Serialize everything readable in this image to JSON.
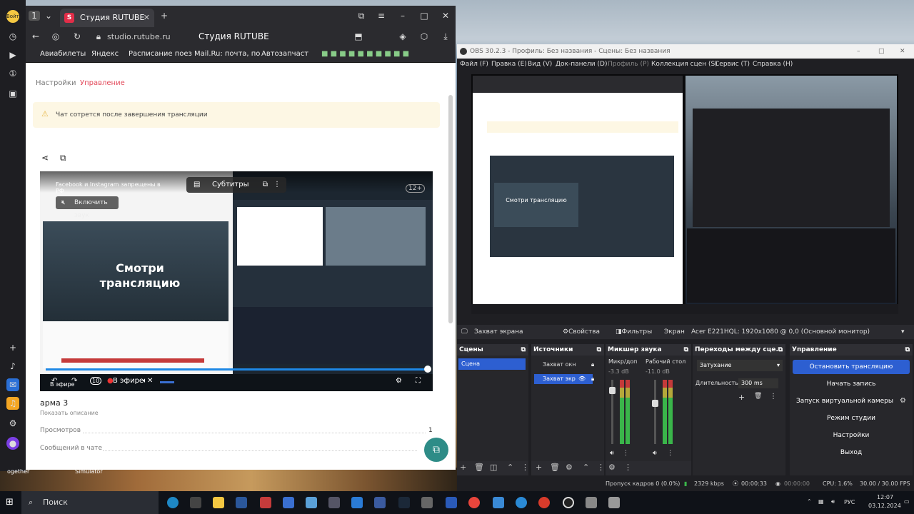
{
  "browser": {
    "tab_label": "Студия RUTUBE",
    "tab_icon": "S",
    "url": "studio.rutube.ru",
    "page_title": "Студия RUTUBE",
    "bookmarks": [
      "Авиабилеты",
      "Яндекс",
      "Расписание поез",
      "Mail.Ru: почта, по",
      "Автозапчаст"
    ]
  },
  "sidebar": {
    "login_label": "Войти",
    "bottom_label": "ogether"
  },
  "studio": {
    "tabs": [
      "Настройки",
      "Управление"
    ],
    "notice": "Чат сотрется после завершения трансляции",
    "player": {
      "overlay_title": "Facebook и Instagram запрещены в РФ",
      "subtitles_label": "Субтитры",
      "mute_label": "Включить звук",
      "age_badge": "12+",
      "big_text": "Смотри трансляцию",
      "small_text": "Смотри трансляцию",
      "live_label": "В эфире",
      "live_label_2": "В эфире",
      "skip_label": "10"
    },
    "video_title": "арма 3",
    "show_description": "Показать описание",
    "views_label": "Просмотров",
    "views_value": "1",
    "chat_label": "Сообщений в чате"
  },
  "obs": {
    "title": "OBS 30.2.3 - Профиль: Без названия - Сцены: Без названия",
    "menu": [
      "Файл (F)",
      "Правка (E)",
      "Вид (V)",
      "Док-панели (D)",
      "Профиль (P)",
      "Коллекция сцен (S)",
      "Сервис (T)",
      "Справка (H)"
    ],
    "source_bar": {
      "source_name": "Захват экрана",
      "properties": "Свойства",
      "filters": "Фильтры",
      "screen_label": "Экран",
      "monitor": "Acer E221HQL: 1920x1080 @ 0,0 (Основной монитор)"
    },
    "scenes": {
      "header": "Сцены",
      "items": [
        "Сцена"
      ]
    },
    "sources": {
      "header": "Источники",
      "items": [
        "Захват окн",
        "Захват экр"
      ]
    },
    "mixer": {
      "header": "Микшер звука",
      "channels": [
        {
          "label": "Микр/доп",
          "db": "-3.3 dB"
        },
        {
          "label": "Рабочий стол",
          "db": "-11.0 dB"
        }
      ],
      "scale": [
        "0",
        "-5",
        "-10",
        "-15",
        "-20",
        "-25",
        "-30",
        "-35",
        "-40",
        "-45",
        "-50",
        "-55",
        "-60"
      ]
    },
    "transitions": {
      "header": "Переходы между сце...",
      "type": "Затухание",
      "duration_label": "Длительность",
      "duration_value": "300 ms"
    },
    "controls": {
      "header": "Управление",
      "buttons": [
        "Остановить трансляцию",
        "Начать запись",
        "Запуск виртуальной камеры",
        "Режим студии",
        "Настройки",
        "Выход"
      ]
    },
    "status": {
      "dropped": "Пропуск кадров 0 (0.0%)",
      "bitrate": "2329 kbps",
      "stream_time": "00:00:33",
      "rec_time": "00:00:00",
      "cpu": "CPU: 1.6%",
      "fps": "30.00 / 30.00 FPS"
    }
  },
  "taskbar": {
    "search_placeholder": "Поиск",
    "lang": "РУС",
    "time": "12:07",
    "date": "03.12.2024"
  },
  "desktop": {
    "simulator_label": "Simulator"
  }
}
